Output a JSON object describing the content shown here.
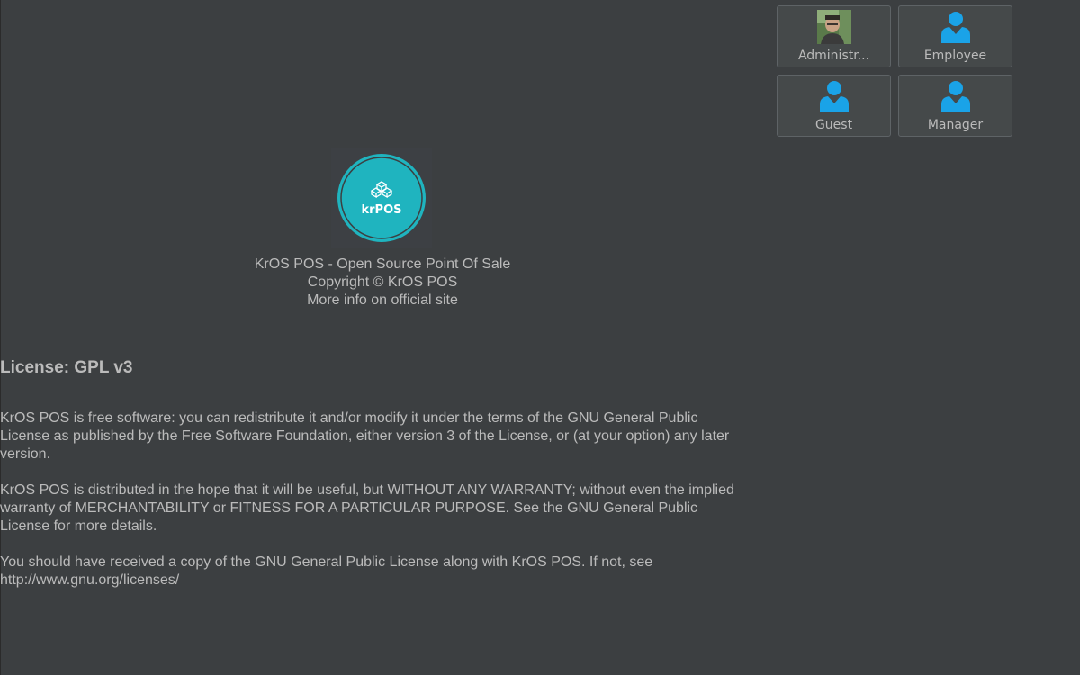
{
  "users": [
    {
      "label": "Administr...",
      "icon": "admin-photo-avatar"
    },
    {
      "label": "Employee",
      "icon": "person-icon"
    },
    {
      "label": "Guest",
      "icon": "person-icon"
    },
    {
      "label": "Manager",
      "icon": "person-icon"
    }
  ],
  "logo": {
    "text": "krPOS",
    "icon": "cube-cluster-icon"
  },
  "about": {
    "line1": "KrOS POS - Open Source Point Of Sale",
    "line2": "Copyright © KrOS POS",
    "line3": "More info on official site"
  },
  "license": {
    "title": "License: GPL v3",
    "paragraphs": [
      "KrOS POS is free software: you can redistribute it and/or modify it under the terms of the GNU General Public License as published by the Free Software Foundation, either version 3 of the License, or (at your option) any later version.",
      "KrOS POS is distributed in the hope that it will be useful, but WITHOUT ANY WARRANTY; without even the implied warranty of MERCHANTABILITY or FITNESS FOR A PARTICULAR PURPOSE. See the GNU General Public License for more details.",
      "You should have received a copy of the GNU General Public License along with KrOS POS. If not, see http://www.gnu.org/licenses/"
    ]
  },
  "colors": {
    "background": "#3c3f41",
    "accent": "#1fb4bf",
    "user_icon": "#1aa3e8",
    "text": "#bbbbbb"
  }
}
